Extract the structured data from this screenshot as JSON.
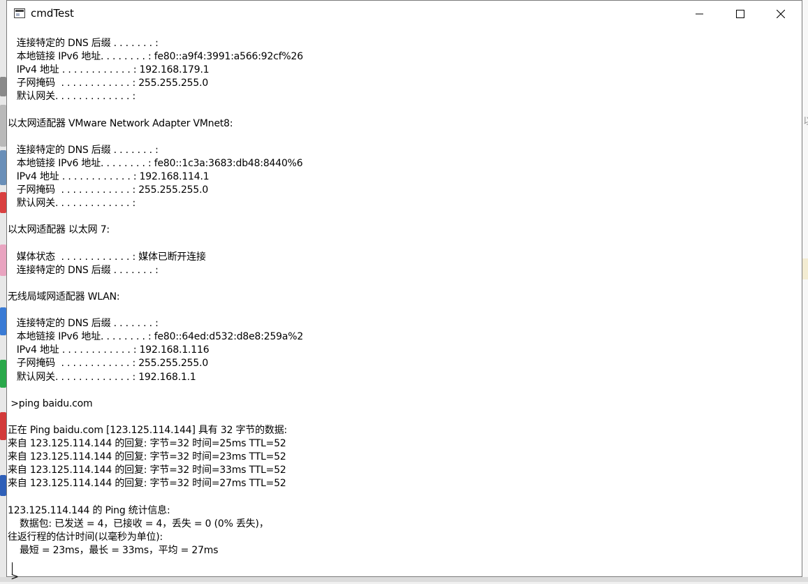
{
  "window": {
    "title": "cmdTest",
    "controls": {
      "minimize_icon": "minimize-icon",
      "maximize_icon": "maximize-icon",
      "close_icon": "close-icon"
    }
  },
  "console": {
    "lines": [
      "   连接特定的 DNS 后缀 . . . . . . . :",
      "   本地链接 IPv6 地址. . . . . . . . : fe80::a9f4:3991:a566:92cf%26",
      "   IPv4 地址 . . . . . . . . . . . . : 192.168.179.1",
      "   子网掩码  . . . . . . . . . . . . : 255.255.255.0",
      "   默认网关. . . . . . . . . . . . . :",
      "",
      "以太网适配器 VMware Network Adapter VMnet8:",
      "",
      "   连接特定的 DNS 后缀 . . . . . . . :",
      "   本地链接 IPv6 地址. . . . . . . . : fe80::1c3a:3683:db48:8440%6",
      "   IPv4 地址 . . . . . . . . . . . . : 192.168.114.1",
      "   子网掩码  . . . . . . . . . . . . : 255.255.255.0",
      "   默认网关. . . . . . . . . . . . . :",
      "",
      "以太网适配器 以太网 7:",
      "",
      "   媒体状态  . . . . . . . . . . . . : 媒体已断开连接",
      "   连接特定的 DNS 后缀 . . . . . . . :",
      "",
      "无线局域网适配器 WLAN:",
      "",
      "   连接特定的 DNS 后缀 . . . . . . . :",
      "   本地链接 IPv6 地址. . . . . . . . : fe80::64ed:d532:d8e8:259a%2",
      "   IPv4 地址 . . . . . . . . . . . . : 192.168.1.116",
      "   子网掩码  . . . . . . . . . . . . : 255.255.255.0",
      "   默认网关. . . . . . . . . . . . . : 192.168.1.1",
      "",
      " >ping baidu.com",
      "",
      "正在 Ping baidu.com [123.125.114.144] 具有 32 字节的数据:",
      "来自 123.125.114.144 的回复: 字节=32 时间=25ms TTL=52",
      "来自 123.125.114.144 的回复: 字节=32 时间=23ms TTL=52",
      "来自 123.125.114.144 的回复: 字节=32 时间=33ms TTL=52",
      "来自 123.125.114.144 的回复: 字节=32 时间=27ms TTL=52",
      "",
      "123.125.114.144 的 Ping 统计信息:",
      "    数据包: 已发送 = 4，已接收 = 4，丢失 = 0 (0% 丢失)，",
      "往返行程的估计时间(以毫秒为单位):",
      "    最短 = 23ms，最长 = 33ms，平均 = 27ms",
      "",
      " >"
    ]
  },
  "desktop": {
    "right_edge_glyph": "以"
  }
}
